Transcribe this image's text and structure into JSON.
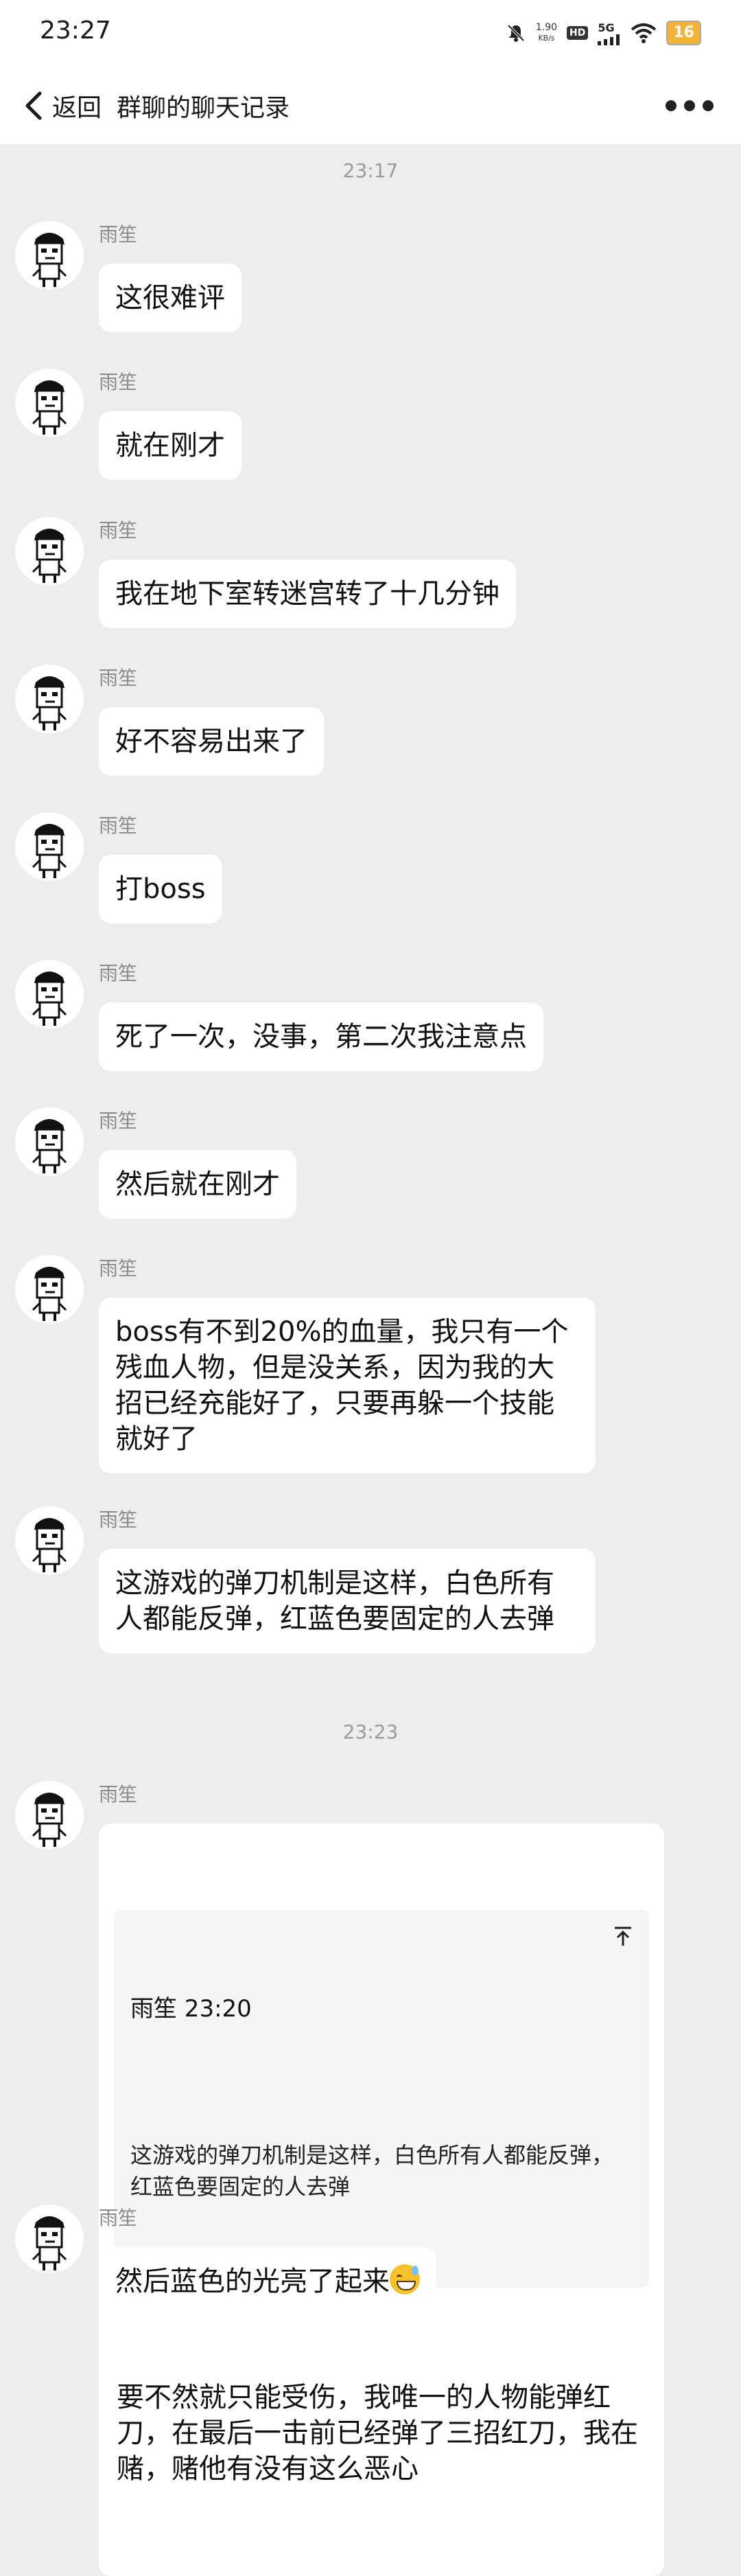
{
  "status_bar": {
    "time": "23:27",
    "net_speed_value": "1.90",
    "net_speed_unit": "KB/s",
    "hd": "HD",
    "network": "5G",
    "battery": "16"
  },
  "nav": {
    "back_label": "返回",
    "title": "群聊的聊天记录"
  },
  "chat": {
    "timestamps": [
      "23:17",
      "23:23"
    ],
    "messages": [
      {
        "sender": "雨笙",
        "text": "这很难评"
      },
      {
        "sender": "雨笙",
        "text": "就在刚才"
      },
      {
        "sender": "雨笙",
        "text": "我在地下室转迷宫转了十几分钟"
      },
      {
        "sender": "雨笙",
        "text": "好不容易出来了"
      },
      {
        "sender": "雨笙",
        "text": "打boss"
      },
      {
        "sender": "雨笙",
        "text": "死了一次，没事，第二次我注意点"
      },
      {
        "sender": "雨笙",
        "text": "然后就在刚才"
      },
      {
        "sender": "雨笙",
        "text": "boss有不到20%的血量，我只有一个残血人物，但是没关系，因为我的大招已经充能好了，只要再躲一个技能就好了"
      },
      {
        "sender": "雨笙",
        "text": "这游戏的弹刀机制是这样，白色所有人都能反弹，红蓝色要固定的人去弹"
      },
      {
        "sender": "雨笙",
        "quote": {
          "header": "雨笙 23:20",
          "text": "这游戏的弹刀机制是这样，白色所有人都能反弹，红蓝色要固定的人去弹"
        },
        "text": "要不然就只能受伤，我唯一的人物能弹红刀，在最后一击前已经弹了三招红刀，我在赌，赌他有没有这么恶心"
      },
      {
        "sender": "雨笙",
        "text": "然后蓝色的光亮了起来",
        "emoji": "sweat-smile-icon"
      }
    ]
  }
}
